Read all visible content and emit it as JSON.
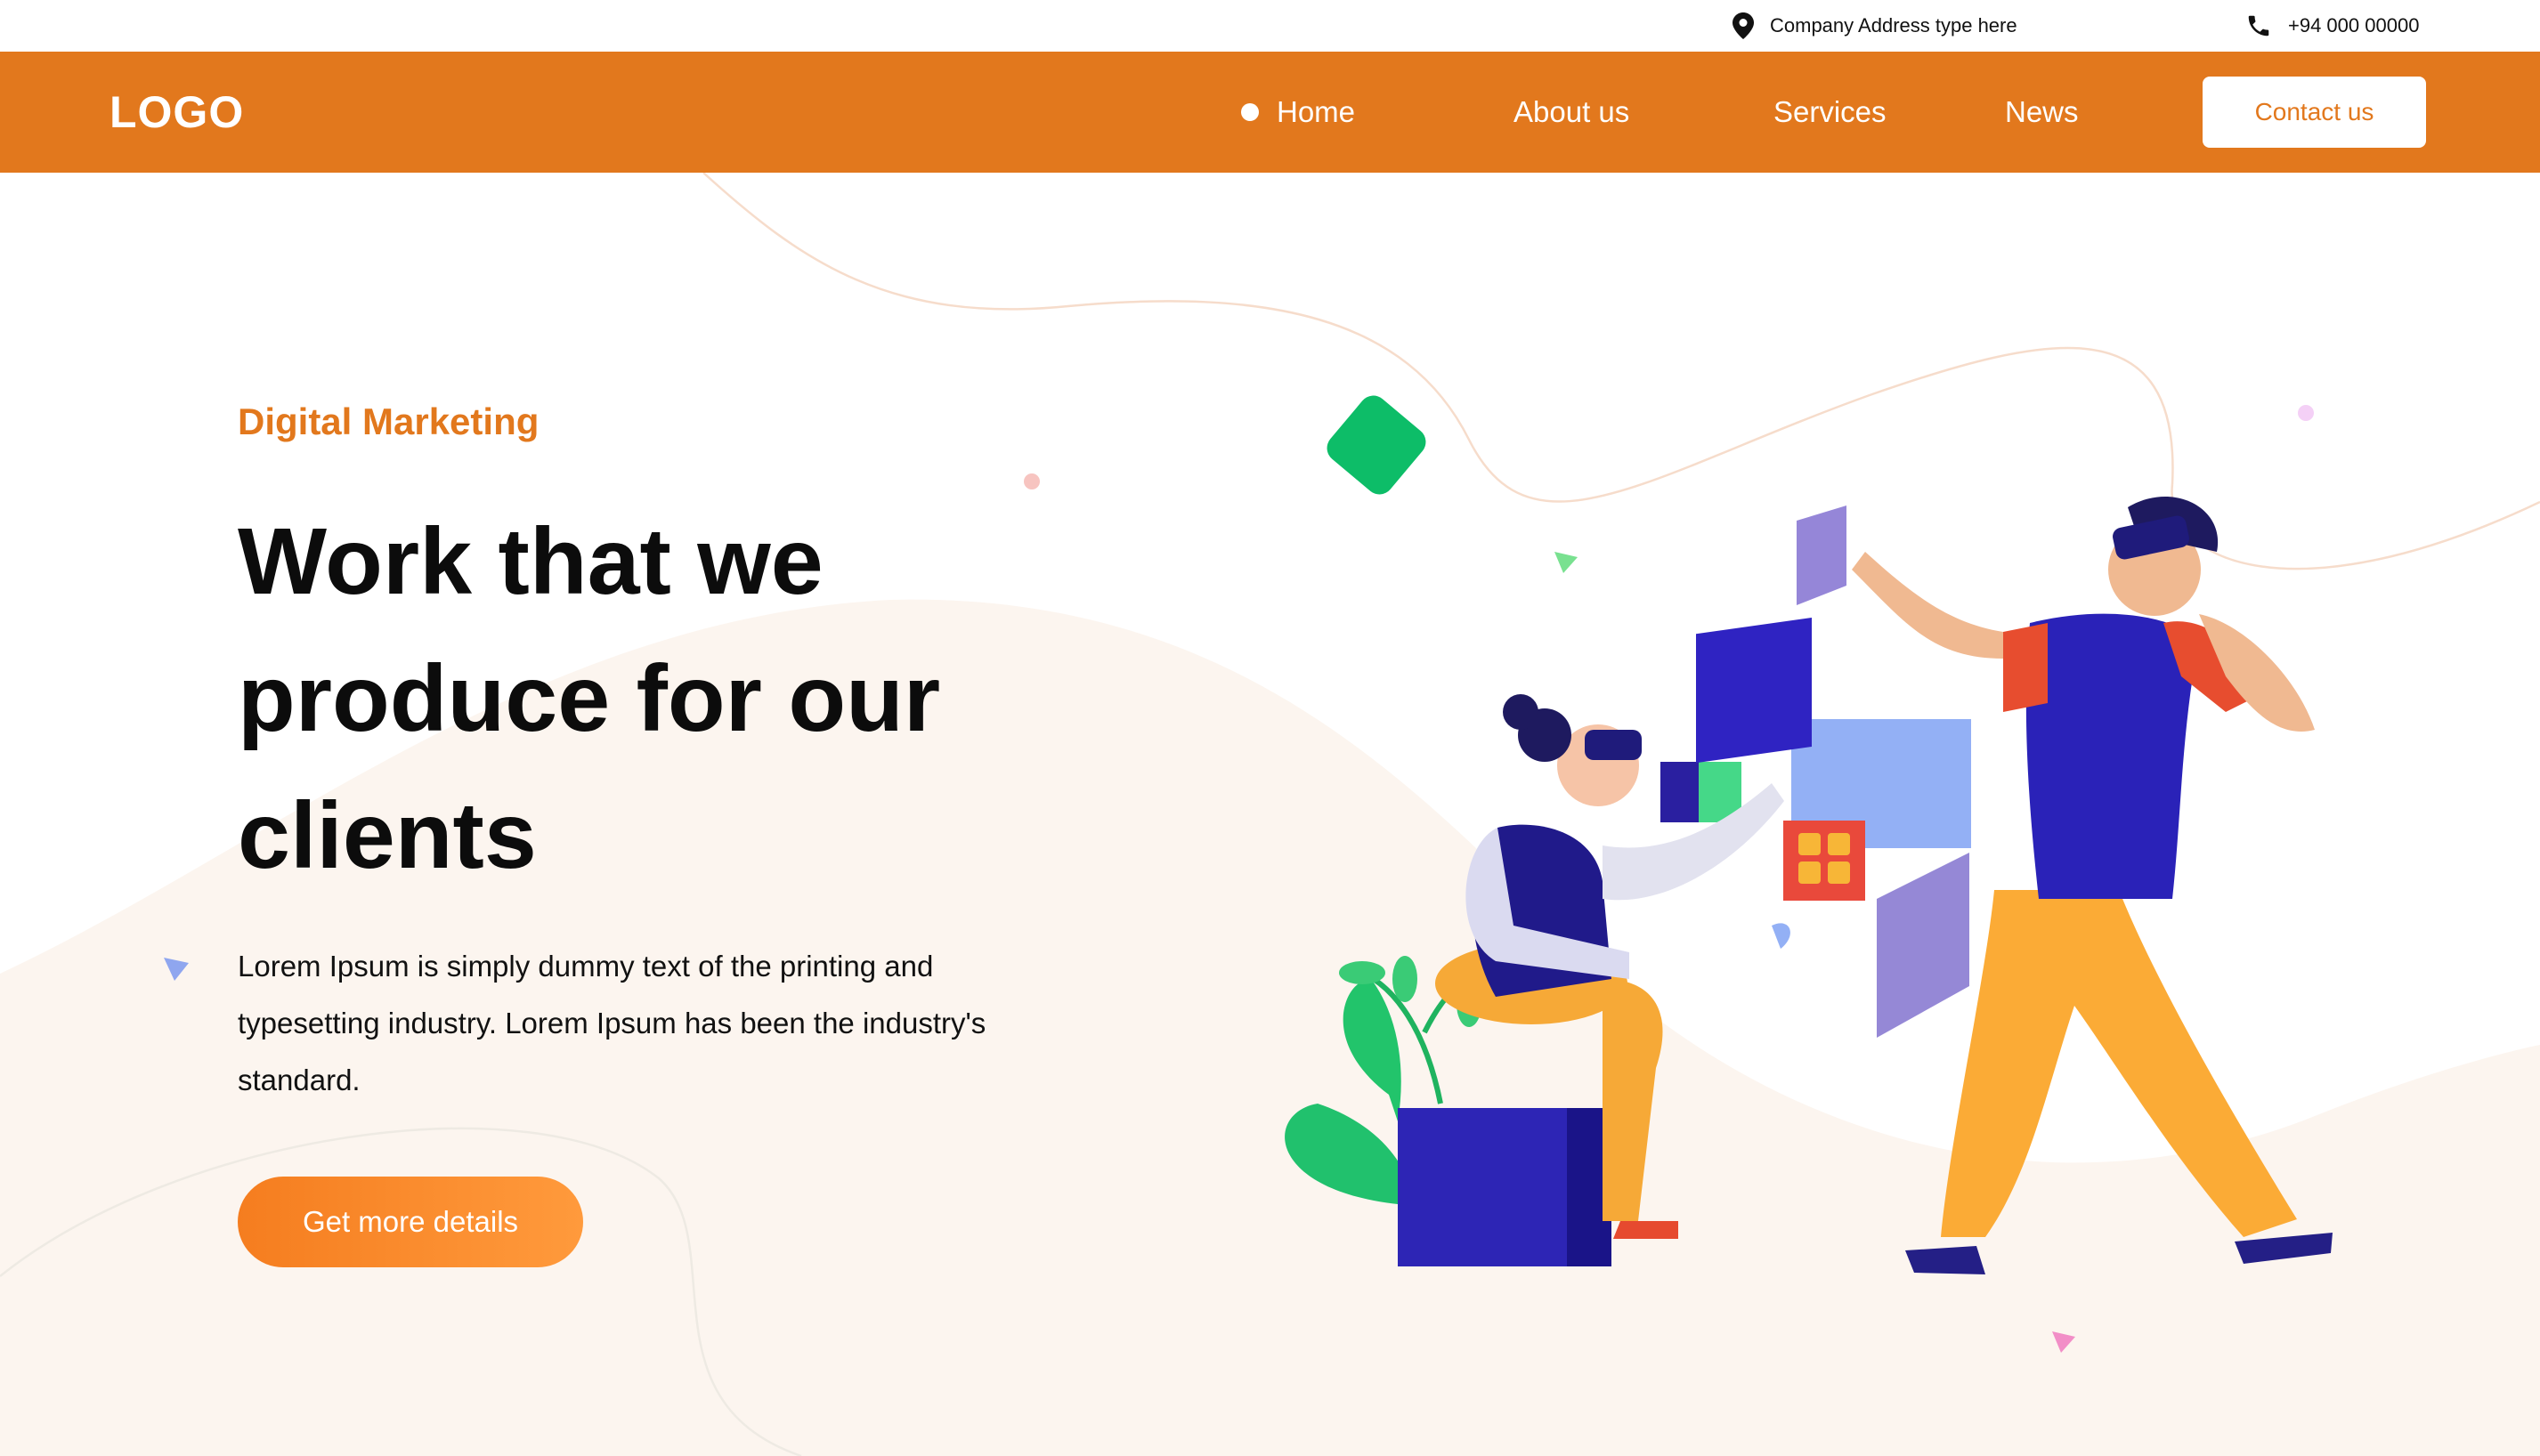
{
  "topbar": {
    "address": "Company Address type here",
    "phone": "+94 000 00000",
    "address_icon": "location-pin-icon",
    "phone_icon": "phone-icon"
  },
  "nav": {
    "logo": "LOGO",
    "items": [
      {
        "label": "Home",
        "active": true
      },
      {
        "label": "About us"
      },
      {
        "label": "Services"
      },
      {
        "label": "News"
      }
    ],
    "contact_label": "Contact us"
  },
  "hero": {
    "eyebrow": "Digital Marketing",
    "headline_line1": "Work that we",
    "headline_line2": "produce for our",
    "headline_line3": "clients",
    "body_line1": "Lorem Ipsum is simply dummy text of the printing and",
    "body_line2": "typesetting industry. Lorem Ipsum has been the industry's",
    "body_line3": "standard.",
    "cta_label": "Get more details"
  },
  "colors": {
    "brand": "#e2781d",
    "cta_gradient_start": "#f57d1f",
    "cta_gradient_end": "#ff9a3c",
    "hero_blob": "#fcf5ef",
    "text_dark": "#0c0c0c"
  }
}
